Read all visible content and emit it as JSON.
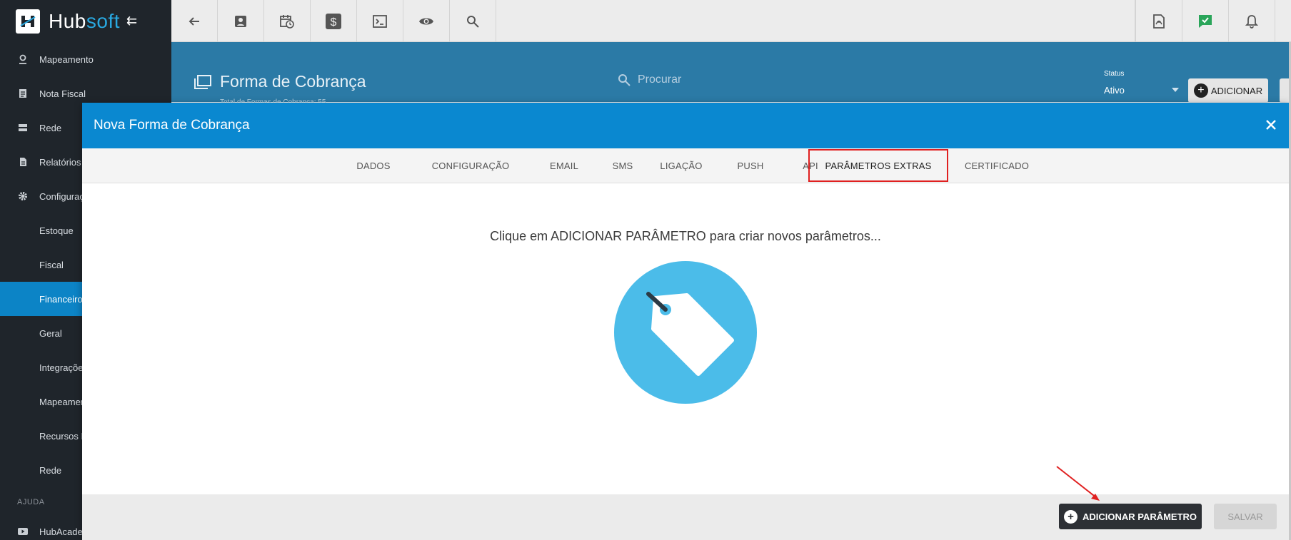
{
  "app": {
    "logo_main": "Hub",
    "logo_accent": "soft",
    "collapse_glyph": "⇇"
  },
  "sidebar": {
    "items": [
      {
        "label": "Mapeamento",
        "icon": "map-pin-icon"
      },
      {
        "label": "Nota Fiscal",
        "icon": "document-icon"
      },
      {
        "label": "Rede",
        "icon": "server-icon"
      },
      {
        "label": "Relatórios",
        "icon": "report-icon"
      },
      {
        "label": "Configuraç",
        "icon": "gear-icon"
      }
    ],
    "sub_items": [
      {
        "label": "Estoque",
        "active": false
      },
      {
        "label": "Fiscal",
        "active": false
      },
      {
        "label": "Financeiro",
        "active": true
      },
      {
        "label": "Geral",
        "active": false
      },
      {
        "label": "Integraçõe",
        "active": false
      },
      {
        "label": "Mapeamen",
        "active": false
      },
      {
        "label": "Recursos H",
        "active": false
      },
      {
        "label": "Rede",
        "active": false
      }
    ],
    "section_help": "AJUDA",
    "help_item": {
      "label": "HubAcade",
      "icon": "youtube-icon"
    }
  },
  "toolbar": {
    "left_icons": [
      "back-arrow-icon",
      "contact-card-icon",
      "calendar-clock-icon",
      "dollar-icon",
      "terminal-icon",
      "eye-icon",
      "search-icon"
    ],
    "right_icons": [
      "pdf-icon",
      "chat-check-icon",
      "bell-icon"
    ]
  },
  "page": {
    "title": "Forma de Cobrança",
    "subtitle": "Total de Formas de Cobrança: 55",
    "search_placeholder": "Procurar",
    "status_label": "Status",
    "status_value": "Ativo",
    "add_button": "ADICIONAR"
  },
  "modal": {
    "title": "Nova Forma de Cobrança",
    "tabs": [
      "DADOS",
      "CONFIGURAÇÃO",
      "EMAIL",
      "SMS",
      "LIGAÇÃO",
      "PUSH",
      "API",
      "PARÂMETROS EXTRAS",
      "CERTIFICADO"
    ],
    "active_tab": "PARÂMETROS EXTRAS",
    "empty_message": "Clique em ADICIONAR PARÂMETRO para criar novos parâmetros...",
    "add_param_button": "ADICIONAR PARÂMETRO",
    "save_button": "SALVAR"
  },
  "colors": {
    "sidebar_bg": "#1f252b",
    "accent_blue": "#0a88d0",
    "active_nav": "#0c84c6",
    "tag_circle": "#4bbce9",
    "highlight_red": "#e02020"
  }
}
